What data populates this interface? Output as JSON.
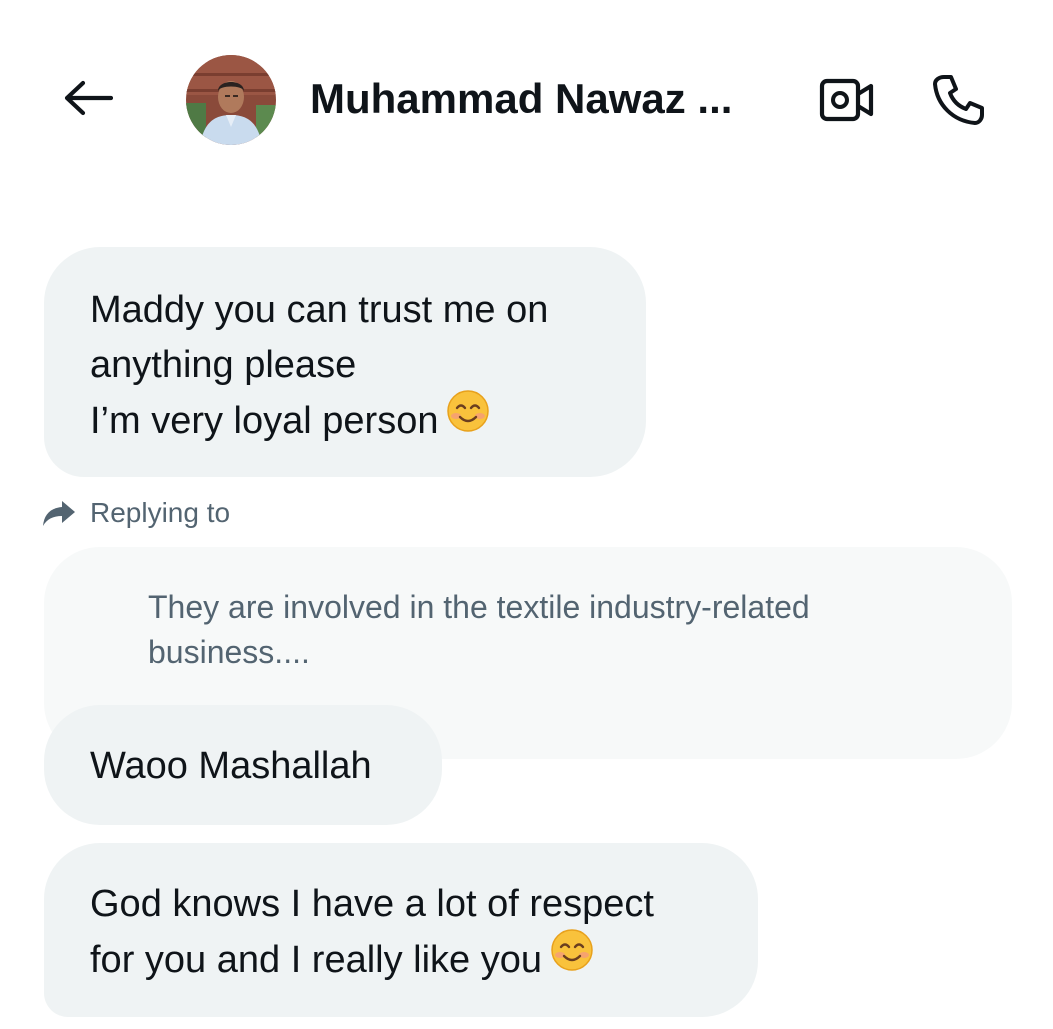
{
  "header": {
    "title": "Muhammad Nawaz ...",
    "back_icon": "arrow-left-icon",
    "video_icon": "video-camera-icon",
    "call_icon": "phone-icon"
  },
  "messages": [
    {
      "lines": [
        "Maddy you can trust me on",
        "anything please",
        "I’m very loyal person"
      ],
      "emoji": "smiling-face-icon"
    },
    {
      "reply": {
        "label": "Replying to",
        "quoted_lines": [
          "They are involved in the textile industry-related",
          "business...."
        ]
      },
      "lines": [
        "Waoo Mashallah"
      ]
    },
    {
      "lines": [
        "God knows I have a lot of respect",
        "for you and I really like you"
      ],
      "emoji": "smiling-face-icon"
    }
  ],
  "colors": {
    "bubble_bg": "#eff3f4",
    "quoted_bg": "#f7f9f9",
    "text": "#0f1419",
    "secondary_text": "#536471"
  }
}
